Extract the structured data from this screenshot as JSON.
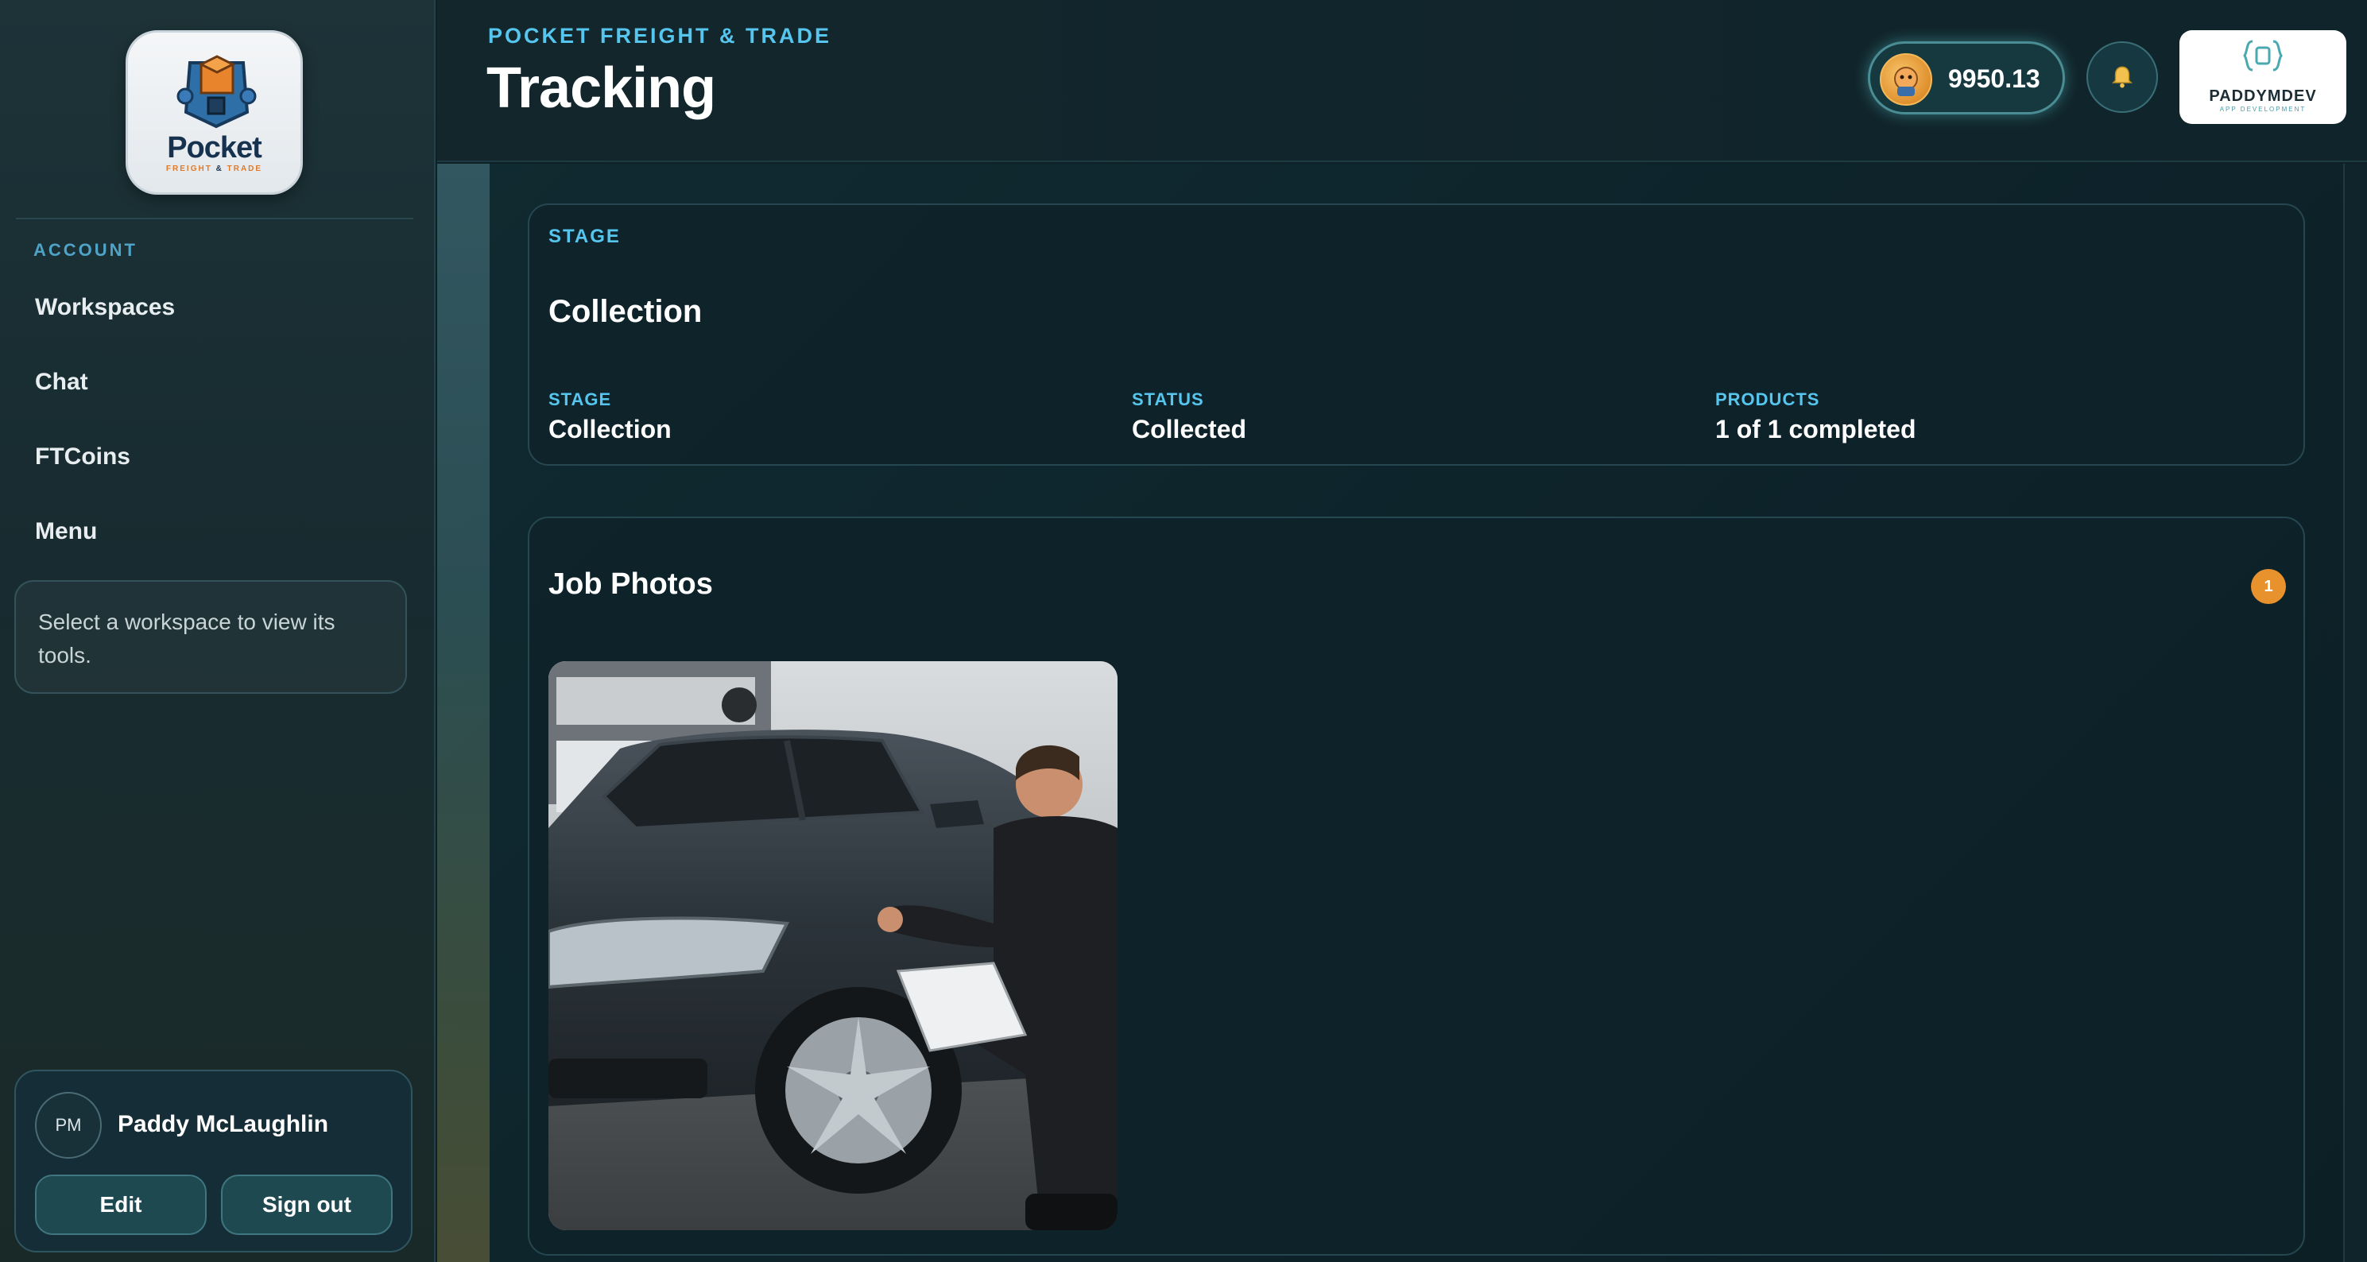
{
  "sidebar": {
    "logo": {
      "word": "Pocket",
      "sub_a": "FREIGHT",
      "sub_amp": "&",
      "sub_b": "TRADE"
    },
    "section_label": "ACCOUNT",
    "items": [
      {
        "label": "Workspaces"
      },
      {
        "label": "Chat"
      },
      {
        "label": "FTCoins"
      },
      {
        "label": "Menu"
      }
    ],
    "hint": "Select a workspace to view its tools.",
    "user": {
      "initials": "PM",
      "name": "Paddy McLaughlin",
      "edit_label": "Edit",
      "signout_label": "Sign out"
    }
  },
  "header": {
    "brand_tag": "POCKET FREIGHT & TRADE",
    "title": "Tracking",
    "coins": "9950.13",
    "coin_icon": "coin-mascot-icon",
    "bell_icon": "bell-icon",
    "dev_logo": {
      "name": "PADDYMDEV",
      "sub": "APP DEVELOPMENT"
    }
  },
  "stage_card": {
    "eyebrow": "STAGE",
    "heading": "Collection",
    "meta": [
      {
        "label": "STAGE",
        "value": "Collection"
      },
      {
        "label": "STATUS",
        "value": "Collected"
      },
      {
        "label": "PRODUCTS",
        "value": "1 of 1 completed"
      }
    ]
  },
  "photos_card": {
    "title": "Job Photos",
    "count": "1"
  },
  "colors": {
    "accent": "#56c6ee",
    "badge": "#e8922e",
    "background": "#0e2127"
  }
}
